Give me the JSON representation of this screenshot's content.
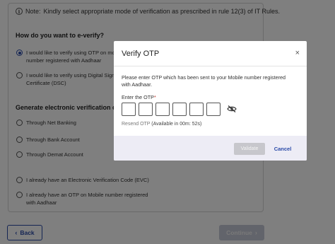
{
  "background": {
    "note_label": "Note:",
    "note_text": "Kindly select appropriate mode of verification as prescribed in rule 12(3) of IT Rules.",
    "question_title": "How do you want to e-verify?",
    "options_primary": [
      {
        "label": "I would like to verify using OTP on mobile number registered with Aadhaar",
        "selected": true
      },
      {
        "label": "I would like to verify using Digital Signature Certificate (DSC)",
        "selected": false
      }
    ],
    "evc_title": "Generate electronic verification code (EVC)",
    "options_evc": [
      {
        "label": "Through Net Banking",
        "selected": false
      },
      {
        "label": "Through Bank Account",
        "selected": false
      },
      {
        "label": "Through Demat Account",
        "selected": false
      }
    ],
    "options_other": [
      {
        "label": "I already have an Electronic Verification Code (EVC)",
        "selected": false
      },
      {
        "label": "I already have an OTP on Mobile number registered with Aadhaar",
        "selected": false
      }
    ],
    "back_label": "Back",
    "continue_label": "Continue"
  },
  "modal": {
    "title": "Verify OTP",
    "close_glyph": "×",
    "message": "Please enter OTP which has been sent to your Mobile number registered with Aadhaar.",
    "otp_label": "Enter the OTP",
    "required_mark": "*",
    "otp_values": [
      "",
      "",
      "",
      "",
      "",
      ""
    ],
    "resend_label": "Resend OTP",
    "timer_text": "(Available in  00m: 52s)",
    "validate_label": "Validate",
    "cancel_label": "Cancel"
  },
  "colors": {
    "accent": "#2a4aa8",
    "overlay": "rgba(0,0,0,0.5)",
    "footer_bg": "#edecf5",
    "disabled_btn": "#c7c7cc"
  },
  "icons": {
    "info": "info-icon",
    "close": "close-icon",
    "visibility": "eye-slash-icon",
    "back": "chevron-left-icon",
    "continue": "chevron-right-icon"
  }
}
